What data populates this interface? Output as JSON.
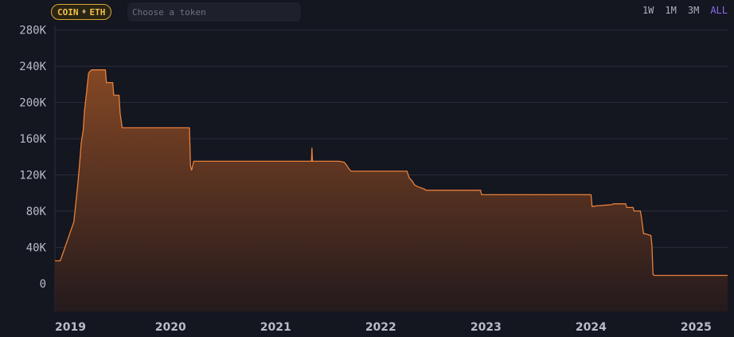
{
  "toolbar": {
    "token_badge": {
      "symbol": "COIN",
      "chain_icon": "ethereum-diamond-icon",
      "chain": "ETH"
    },
    "search": {
      "placeholder": "Choose a token",
      "value": ""
    },
    "ranges": [
      {
        "label": "1W",
        "active": false
      },
      {
        "label": "1M",
        "active": false
      },
      {
        "label": "3M",
        "active": false
      },
      {
        "label": "ALL",
        "active": true
      }
    ]
  },
  "colors": {
    "background": "#141620",
    "line": "#e8803a",
    "fill_top": "#8a4a25",
    "fill_bottom": "#251a1c",
    "grid": "#2b2e3a",
    "active_range": "#8c6cf0",
    "badge": "#f2c14e"
  },
  "chart_data": {
    "type": "area",
    "title": "",
    "xlabel": "",
    "ylabel": "",
    "ylim": [
      -31000,
      285000
    ],
    "y_ticks": [
      0,
      40000,
      80000,
      120000,
      160000,
      200000,
      240000,
      280000
    ],
    "y_tick_labels": [
      "0",
      "40K",
      "80K",
      "120K",
      "160K",
      "200K",
      "240K",
      "280K"
    ],
    "x_range": [
      2018.9,
      2025.3
    ],
    "x_ticks": [
      2019,
      2020,
      2021,
      2022,
      2023,
      2024,
      2025
    ],
    "x_tick_labels": [
      "2019",
      "2020",
      "2021",
      "2022",
      "2023",
      "2024",
      "2025"
    ],
    "grid": true,
    "legend": "none",
    "series": [
      {
        "x": [
          2018.9,
          2018.95,
          2018.96,
          2018.99,
          2019.02,
          2019.05,
          2019.08,
          2019.1,
          2019.12,
          2019.14,
          2019.15,
          2019.17,
          2019.18,
          2019.19,
          2019.2,
          2019.22,
          2019.23,
          2019.25,
          2019.27,
          2019.3,
          2019.38,
          2019.39,
          2019.45,
          2019.46,
          2019.51,
          2019.52,
          2019.53,
          2019.54,
          2020.18,
          2020.19,
          2020.2,
          2020.21,
          2020.22,
          2021.34,
          2021.345,
          2021.35,
          2021.355,
          2021.6,
          2021.65,
          2021.68,
          2021.7,
          2021.72,
          2022.25,
          2022.27,
          2022.3,
          2022.32,
          2022.35,
          2022.42,
          2022.43,
          2022.95,
          2022.96,
          2024.0,
          2024.01,
          2024.07,
          2024.08,
          2024.2,
          2024.21,
          2024.33,
          2024.34,
          2024.4,
          2024.41,
          2024.47,
          2024.48,
          2024.5,
          2024.51,
          2024.57,
          2024.58,
          2024.59,
          2024.6,
          2025.3
        ],
        "y": [
          25000,
          25000,
          28000,
          38000,
          48000,
          58000,
          68000,
          90000,
          112000,
          140000,
          155000,
          170000,
          190000,
          200000,
          210000,
          232000,
          234000,
          236000,
          236000,
          236000,
          236000,
          222000,
          222000,
          208000,
          208000,
          188000,
          180000,
          172000,
          172000,
          130000,
          125000,
          130000,
          135000,
          135000,
          150000,
          135000,
          135000,
          135000,
          134000,
          130000,
          126000,
          124000,
          124000,
          117000,
          113000,
          109000,
          107000,
          104000,
          103000,
          103000,
          98000,
          98000,
          85000,
          86000,
          86000,
          87000,
          88000,
          88000,
          84000,
          84000,
          80000,
          80000,
          73000,
          55000,
          55000,
          53000,
          42000,
          10000,
          9000,
          9000
        ]
      }
    ]
  }
}
